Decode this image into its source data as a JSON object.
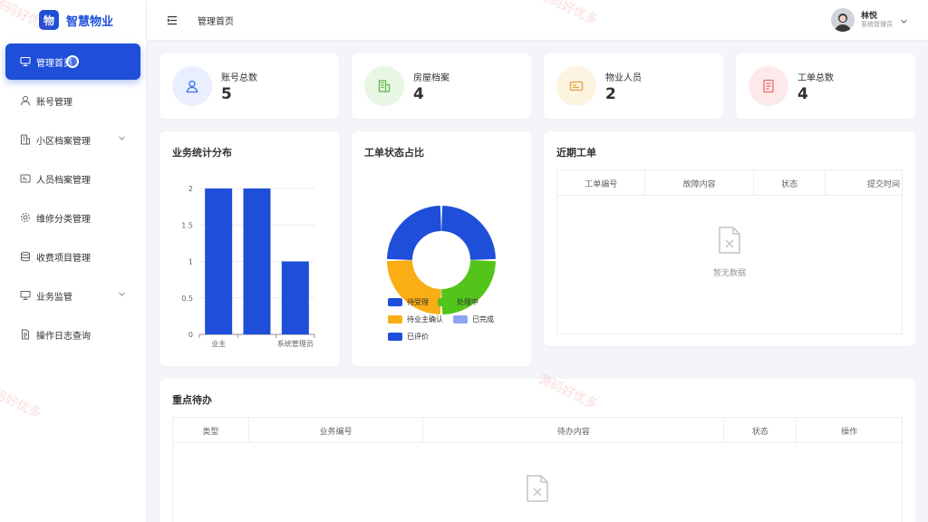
{
  "brand": {
    "logo_char": "物",
    "name": "智慧物业"
  },
  "sidebar": {
    "items": [
      {
        "label": "管理首页",
        "icon": "monitor-icon",
        "active": true
      },
      {
        "label": "账号管理",
        "icon": "user-icon"
      },
      {
        "label": "小区档案管理",
        "icon": "building-icon",
        "expandable": true
      },
      {
        "label": "人员档案管理",
        "icon": "id-card-icon"
      },
      {
        "label": "维修分类管理",
        "icon": "gear-icon"
      },
      {
        "label": "收费项目管理",
        "icon": "database-icon"
      },
      {
        "label": "业务监管",
        "icon": "monitor-icon",
        "expandable": true
      },
      {
        "label": "操作日志查询",
        "icon": "document-icon"
      }
    ]
  },
  "header": {
    "breadcrumb": "管理首页",
    "user_name": "林悦",
    "user_role": "系统管理员"
  },
  "stats": [
    {
      "label": "账号总数",
      "value": "5",
      "icon": "user-icon",
      "color": "#3b6fe0",
      "bg": "#e9efff"
    },
    {
      "label": "房屋档案",
      "value": "4",
      "icon": "building-icon",
      "color": "#5fb74a",
      "bg": "#e8f6e4"
    },
    {
      "label": "物业人员",
      "value": "2",
      "icon": "id-card-icon",
      "color": "#e6a23c",
      "bg": "#fdf3e1"
    },
    {
      "label": "工单总数",
      "value": "4",
      "icon": "document-icon",
      "color": "#e56b6b",
      "bg": "#fde9e9"
    }
  ],
  "bar_panel": {
    "title": "业务统计分布"
  },
  "donut_panel": {
    "title": "工单状态占比"
  },
  "recent_orders": {
    "title": "近期工单",
    "columns": [
      "工单编号",
      "故障内容",
      "状态",
      "提交时间"
    ],
    "empty_text": "暂无数据"
  },
  "todo": {
    "title": "重点待办",
    "columns": [
      "类型",
      "业务编号",
      "待办内容",
      "状态",
      "操作"
    ]
  },
  "watermark_text": "源码好优多",
  "chart_data": [
    {
      "type": "bar",
      "categories": [
        "业主",
        "",
        "系统管理员"
      ],
      "values": [
        2,
        2,
        1
      ],
      "ylim": [
        0,
        2
      ],
      "yticks": [
        "0",
        "0.5",
        "1",
        "1.5",
        "2"
      ],
      "grid": true,
      "color": "#1f4fd8"
    },
    {
      "type": "pie",
      "donut": true,
      "series": [
        {
          "name": "待受理",
          "value": 1,
          "color": "#1f4fd8"
        },
        {
          "name": "处理中",
          "value": 1,
          "color": "#52c41a"
        },
        {
          "name": "待业主确认",
          "value": 1,
          "color": "#faad14"
        },
        {
          "name": "已完成",
          "value": 0,
          "color": "#8fa5f0"
        },
        {
          "name": "已评价",
          "value": 1,
          "color": "#1f4fd8"
        }
      ],
      "legend": "bottom-left"
    }
  ]
}
